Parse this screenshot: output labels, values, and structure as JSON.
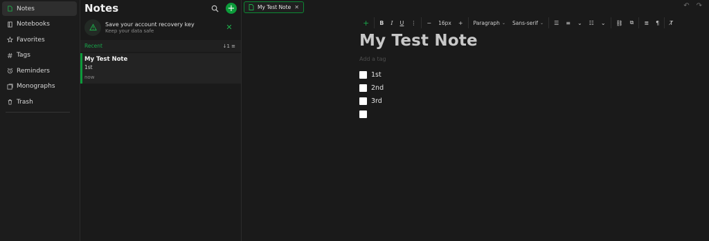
{
  "sidebar": {
    "items": [
      {
        "label": "Notes",
        "icon": "note-icon",
        "active": true
      },
      {
        "label": "Notebooks",
        "icon": "notebook-icon"
      },
      {
        "label": "Favorites",
        "icon": "star-icon"
      },
      {
        "label": "Tags",
        "icon": "hash-icon"
      },
      {
        "label": "Reminders",
        "icon": "alarm-icon"
      },
      {
        "label": "Monographs",
        "icon": "monograph-icon"
      },
      {
        "label": "Trash",
        "icon": "trash-icon"
      }
    ]
  },
  "list": {
    "title": "Notes",
    "recovery_title": "Save your account recovery key",
    "recovery_subtitle": "Keep your data safe",
    "group_label": "Recent",
    "notes": [
      {
        "title": "My Test Note",
        "snippet": "1st",
        "time": "now"
      }
    ]
  },
  "tab": {
    "label": "My Test Note"
  },
  "toolbar": {
    "font_size": "16px",
    "block_type": "Paragraph",
    "font_family": "Sans-serif"
  },
  "document": {
    "title": "My Test Note",
    "tag_placeholder": "Add a tag",
    "checklist": [
      {
        "text": "1st",
        "checked": false
      },
      {
        "text": "2nd",
        "checked": false
      },
      {
        "text": "3rd",
        "checked": false
      },
      {
        "text": "",
        "checked": false
      }
    ]
  },
  "colors": {
    "accent": "#0c9b3a",
    "background": "#1a1a1a",
    "sidebar_bg": "#1c1c1c"
  }
}
